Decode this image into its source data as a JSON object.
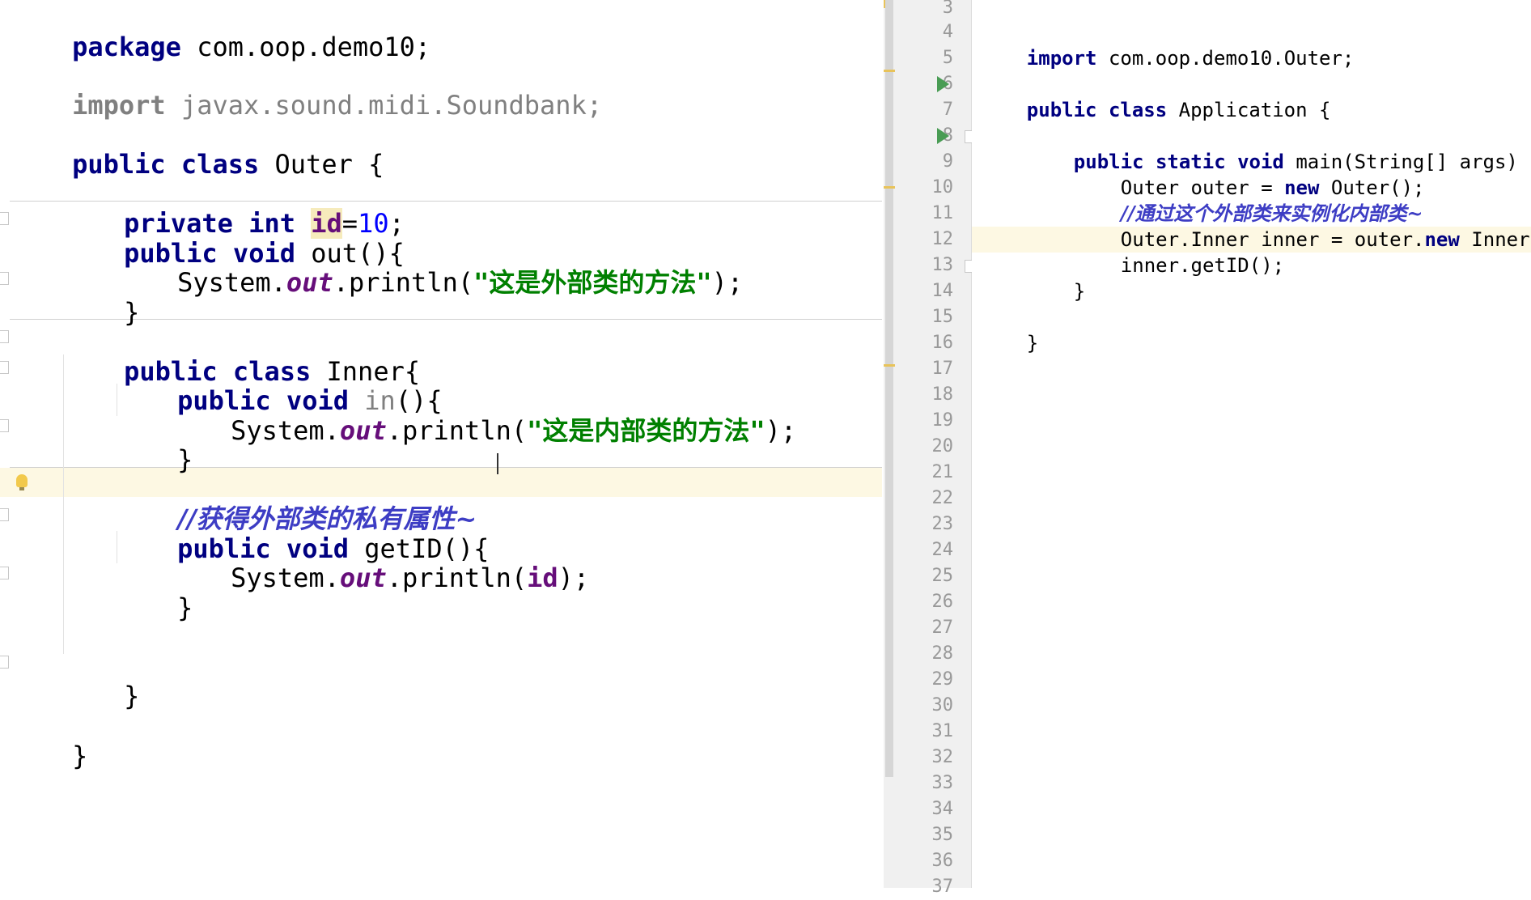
{
  "left_editor": {
    "lines": [
      {
        "k": "package",
        "rest": " com.oop.demo10;"
      },
      {
        "k": "import",
        "rest": " javax.sound.midi.Soundbank;"
      },
      {
        "k": "public class",
        "rest": " Outer {"
      },
      {
        "k": "private int",
        "id": "id",
        "eq": "=",
        "num": "10",
        "end": ";"
      },
      {
        "k": "public void",
        "rest": " out(){"
      },
      {
        "pre": "System.",
        "f": "out",
        "mid": ".println(",
        "s": "\"这是外部类的方法\"",
        "end": ");"
      },
      {
        "rest": "}"
      },
      {
        "k": "public class",
        "rest": " Inner{"
      },
      {
        "k": "public void",
        "gray": " in",
        "rest": "(){"
      },
      {
        "pre": "System.",
        "f": "out",
        "mid": ".println(",
        "s": "\"这是内部类的方法\"",
        "end": ");"
      },
      {
        "rest": "}"
      },
      {
        "c": "//获得外部类的私有属性~"
      },
      {
        "k": "public void",
        "rest": " getID(){"
      },
      {
        "pre": "System.",
        "f": "out",
        "mid": ".println(",
        "id": "id",
        "end": ");"
      },
      {
        "rest": "}"
      },
      {
        "rest": "}"
      },
      {
        "rest": "}"
      }
    ]
  },
  "right_editor": {
    "line_numbers": [
      "3",
      "4",
      "5",
      "6",
      "7",
      "8",
      "9",
      "10",
      "11",
      "12",
      "13",
      "14",
      "15",
      "16",
      "17",
      "18",
      "19",
      "20",
      "21",
      "22",
      "23",
      "24",
      "25",
      "26",
      "27",
      "28",
      "29",
      "30",
      "31",
      "32",
      "33",
      "34",
      "35",
      "36",
      "37"
    ],
    "lines": {
      "l4": {
        "k": "import",
        "rest": " com.oop.demo10.Outer;"
      },
      "l6": {
        "k": "public class",
        "rest": " Application {"
      },
      "l8": {
        "k": "public static void",
        "rest": " main(String[] args) {"
      },
      "l9": {
        "a": "Outer outer = ",
        "k": "new",
        "b": " Outer();"
      },
      "l10": {
        "c": "//通过这个外部类来实例化内部类~"
      },
      "l11": {
        "a": "Outer.Inner inner = outer.",
        "k": "new",
        "b": " Inner();"
      },
      "l12": {
        "a": "inner.getID();"
      },
      "l13": {
        "a": "}"
      },
      "l15": {
        "a": "}"
      }
    }
  }
}
